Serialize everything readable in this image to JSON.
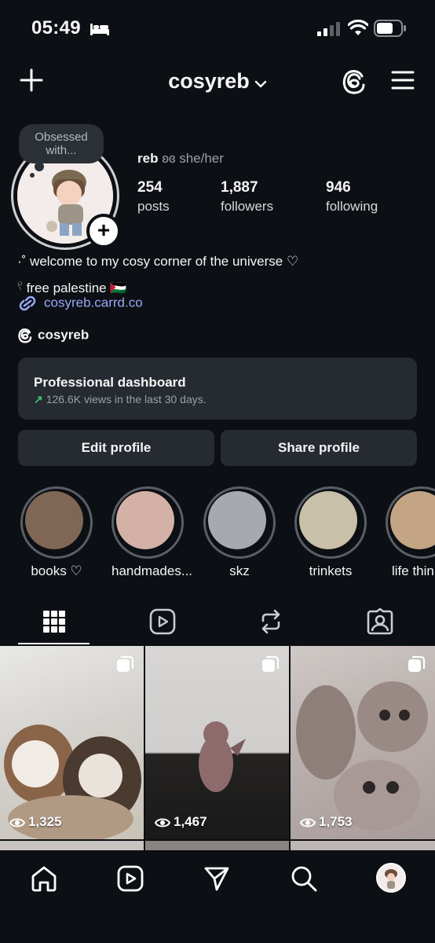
{
  "status": {
    "time": "05:49"
  },
  "header": {
    "username": "cosyreb"
  },
  "profile": {
    "note": "Obsessed with...",
    "name": "reb",
    "name_symbol": "ʚɞ",
    "pronouns": "she/her",
    "stats": [
      {
        "value": "254",
        "label": "posts"
      },
      {
        "value": "1,887",
        "label": "followers"
      },
      {
        "value": "946",
        "label": "following"
      }
    ],
    "bio_line1": "·˚ welcome to my cosy corner of the universe ♡",
    "bio_line2": "𓍢 free palestine 🇵🇸",
    "link": "cosyreb.carrd.co",
    "threads_handle": "cosyreb"
  },
  "dashboard": {
    "title": "Professional dashboard",
    "subtitle": "126.6K views in the last 30 days."
  },
  "buttons": {
    "edit": "Edit profile",
    "share": "Share profile"
  },
  "highlights": [
    {
      "label": "books ♡",
      "color": "#806654"
    },
    {
      "label": "handmades...",
      "color": "#d4b1a6"
    },
    {
      "label": "skz",
      "color": "#a6a9b0"
    },
    {
      "label": "trinkets",
      "color": "#c8c0a8"
    },
    {
      "label": "life thin",
      "color": "#c3a586"
    }
  ],
  "tabs": [
    "grid-icon",
    "reels-icon",
    "reposts-icon",
    "tagged-icon"
  ],
  "posts": [
    {
      "views": "1,325"
    },
    {
      "views": "1,467"
    },
    {
      "views": "1,753"
    }
  ],
  "nav": [
    "home-icon",
    "reels-icon",
    "send-icon",
    "search-icon",
    "profile-avatar"
  ]
}
